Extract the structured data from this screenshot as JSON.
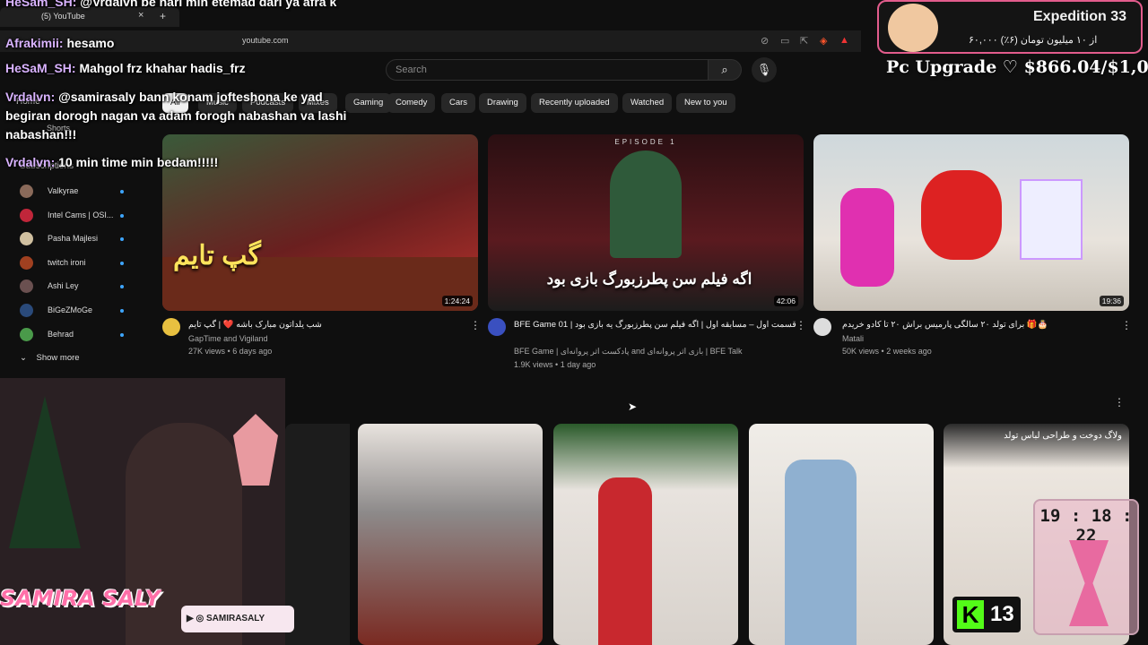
{
  "browser": {
    "tab_title": "(5) YouTube",
    "new_tab": "+",
    "close": "×",
    "url": "youtube.com"
  },
  "youtube": {
    "search_placeholder": "Search",
    "chips": [
      "All",
      "Music",
      "Podcasts",
      "Mixes",
      "Gaming",
      "Comedy",
      "Cars",
      "Drawing",
      "Recently uploaded",
      "Watched",
      "New to you"
    ],
    "sidebar": {
      "home": "Home",
      "shorts": "Shorts",
      "subscriptions": "Subscriptions",
      "show_more": "Show more",
      "subs": [
        {
          "name": "Valkyrae",
          "color": "#8a6a5a"
        },
        {
          "name": "Intel Cams | OSI...",
          "color": "#c0263a"
        },
        {
          "name": "Pasha Majlesi",
          "color": "#d0c0a0"
        },
        {
          "name": "twitch ironi",
          "color": "#a04020"
        },
        {
          "name": "Ashi Ley",
          "color": "#6a5050"
        },
        {
          "name": "BiGeZMoGe",
          "color": "#2a4a7a"
        },
        {
          "name": "Behrad",
          "color": "#4a9a4a"
        }
      ]
    },
    "videos": [
      {
        "title": "شب یلداتون مبارک باشه ❤️ | گپ تایم",
        "channel": "GapTime and Vigiland",
        "views": "27K views",
        "age": "6 days ago",
        "duration": "1:24:24",
        "overlay": "گپ تایم"
      },
      {
        "title": "BFE Game 01 | قسمت اول – مسابقه اول | اگه فیلم سن پطرزبورگ یه بازی بود",
        "channel": "BFE Game | پادکست اثر پروانه‌ای and بازی اثر پروانه‌ای | BFE Talk",
        "views": "1.9K views",
        "age": "1 day ago",
        "duration": "42:06",
        "episode": "EPISODE 1",
        "overlay": "اگه فیلم سن پطرزبورگ بازی بود"
      },
      {
        "title": "برای تولد ۲۰ سالگی پارمیس براش ۲۰ تا کادو خریدم 🎁🎂",
        "channel": "Matali",
        "views": "50K views",
        "age": "2 weeks ago",
        "duration": "19:36"
      }
    ],
    "shorts_caption": "ولاگ دوخت و طراحی لباس تولد"
  },
  "overlay": {
    "chat": [
      {
        "user": "HeSam_SH:",
        "msg": "@Vrdalvn be nari min etemad dari ya afra k"
      },
      {
        "user": "Afrakimii:",
        "msg": "hesamo"
      },
      {
        "user": "HeSaM_SH:",
        "msg": "Mahgol frz khahar hadis_frz"
      },
      {
        "user": "Vrdalvn:",
        "msg": "@samirasaly bann konam jofteshona ke yad"
      },
      {
        "user": "",
        "msg": "begiran dorogh nagan va adam forogh nabashan va lashi"
      },
      {
        "user": "",
        "msg": "nabashan!!!"
      },
      {
        "user": "Vrdalvn:",
        "msg": "10 min time min bedam!!!!!"
      }
    ],
    "expedition_title": "Expedition 33",
    "expedition_sub": "۶۰,۰۰۰ از ۱۰ میلیون تومان (۶٪)",
    "goal": "Pc Upgrade ♡ $866.04/$1,000",
    "timer": "19 : 18 : 22",
    "kick_count": "13",
    "logo": "SAMIRA SALY",
    "handle": "▶ ◎ SAMIRASALY"
  },
  "colors": {
    "bg": "#0f0f0f",
    "accent": "#e25c8c",
    "kick": "#53fc18"
  }
}
